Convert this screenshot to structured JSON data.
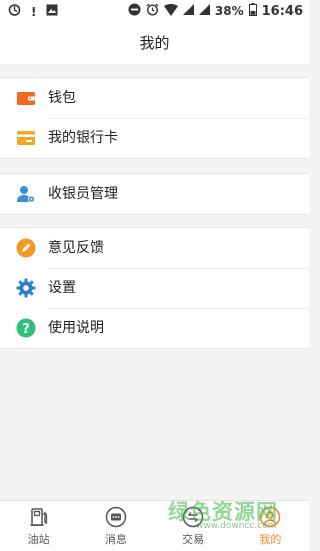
{
  "status_bar": {
    "battery": "38%",
    "time": "16:46"
  },
  "header": {
    "title": "我的"
  },
  "menu_groups": [
    {
      "items": [
        {
          "label": "钱包",
          "icon": "wallet-icon",
          "color": "#f06a1c"
        },
        {
          "label": "我的银行卡",
          "icon": "bank-card-icon",
          "color": "#f2a624"
        }
      ]
    },
    {
      "items": [
        {
          "label": "收银员管理",
          "icon": "cashier-user-icon",
          "color": "#3a8fd6"
        }
      ]
    },
    {
      "items": [
        {
          "label": "意见反馈",
          "icon": "feedback-pencil-icon",
          "color": "#f29a26"
        },
        {
          "label": "设置",
          "icon": "gear-icon",
          "color": "#2d7fd0"
        },
        {
          "label": "使用说明",
          "icon": "help-icon",
          "color": "#2ec07a"
        }
      ]
    }
  ],
  "tabs": [
    {
      "label": "油站",
      "icon": "gas-station-icon"
    },
    {
      "label": "消息",
      "icon": "message-icon"
    },
    {
      "label": "交易",
      "icon": "transaction-icon"
    },
    {
      "label": "我的",
      "icon": "profile-icon",
      "active": true
    }
  ],
  "watermark": {
    "text": "绿色资源网",
    "sub": "www.downcc.com"
  },
  "colors": {
    "accent": "#f08a2c",
    "background": "#f4f4f4"
  }
}
